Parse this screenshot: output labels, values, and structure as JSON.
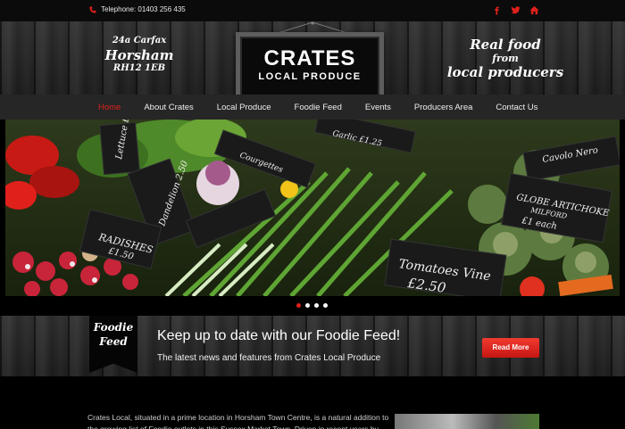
{
  "topbar": {
    "phone": "Telephone: 01403 256 435",
    "social": [
      "facebook-icon",
      "twitter-icon",
      "home-icon"
    ]
  },
  "header": {
    "address": [
      "24a Carfax",
      "Horsham",
      "RH12 1EB"
    ],
    "logo": {
      "line1": "CRATES",
      "line2": "LOCAL PRODUCE"
    },
    "tagline": [
      "Real food",
      "from",
      "local producers"
    ]
  },
  "nav": {
    "items": [
      "Home",
      "About Crates",
      "Local Produce",
      "Foodie Feed",
      "Events",
      "Producers Area",
      "Contact Us"
    ],
    "active": "Home"
  },
  "hero": {
    "chalkboards": [
      "Lettuce £1.95",
      "Dandelion 2.50",
      "Radishes £1.50",
      "Courgettes",
      "Garlic £1.25",
      "Cavolo Nero",
      "Globe Artichoke Milford £1 each",
      "Tomatoes Vine £2.50"
    ],
    "slides": 4,
    "active_slide": 1
  },
  "feed": {
    "ribbon": [
      "Foodie",
      "Feed"
    ],
    "heading": "Keep up to date with our Foodie Feed!",
    "subheading": "The latest news and features from Crates Local Produce",
    "button": "Read More"
  },
  "content": {
    "text": "Crates Local, situated in a prime location in Horsham Town Centre, is a natural addition to the growing list of Foodie outlets in this Sussex Market Town. Driven in recent years by"
  },
  "colors": {
    "accent": "#e0201b",
    "button": "#d9231d",
    "background": "#000000",
    "nav": "#262626"
  }
}
